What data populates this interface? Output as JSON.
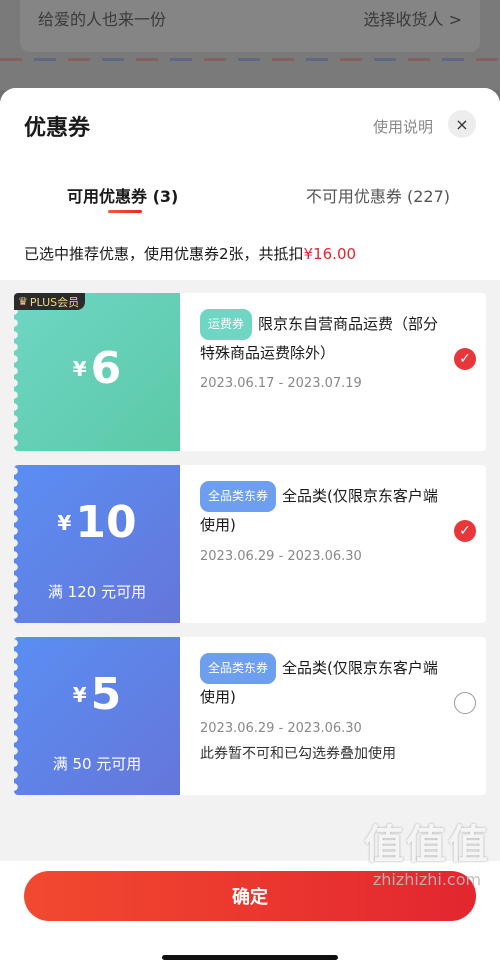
{
  "background_page": {
    "left_text": "给爱的人也来一份",
    "right_text": "选择收货人 >"
  },
  "sheet": {
    "title": "优惠券",
    "help_link": "使用说明",
    "close_icon": "×"
  },
  "tabs": [
    {
      "label": "可用优惠券 (3)"
    },
    {
      "label": "不可用优惠券 (227)"
    }
  ],
  "summary": {
    "prefix": "已选中推荐优惠，使用优惠券2张，共抵扣",
    "amount": "¥16.00"
  },
  "coupons": [
    {
      "badge": "PLUS会员",
      "currency": "¥",
      "value": "6",
      "condition": "",
      "tag": "运费券",
      "title": "限京东自营商品运费（部分特殊商品运费除外）",
      "dates": "2023.06.17 - 2023.07.19",
      "note": "",
      "selected": true
    },
    {
      "badge": "",
      "currency": "¥",
      "value": "10",
      "condition": "满 120 元可用",
      "tag": "全品类东券",
      "title": "全品类(仅限京东客户端使用)",
      "dates": "2023.06.29 - 2023.06.30",
      "note": "",
      "selected": true
    },
    {
      "badge": "",
      "currency": "¥",
      "value": "5",
      "condition": "满 50 元可用",
      "tag": "全品类东券",
      "title": "全品类(仅限京东客户端使用)",
      "dates": "2023.06.29 - 2023.06.30",
      "note": "此券暂不可和已勾选券叠加使用",
      "selected": false
    }
  ],
  "confirm_label": "确定",
  "watermark": {
    "chars": "值值值",
    "domain": "zhizhizhi.com"
  },
  "colors": {
    "accent": "#e3262f",
    "teal": "#6fd6c4",
    "blue": "#6576da"
  }
}
